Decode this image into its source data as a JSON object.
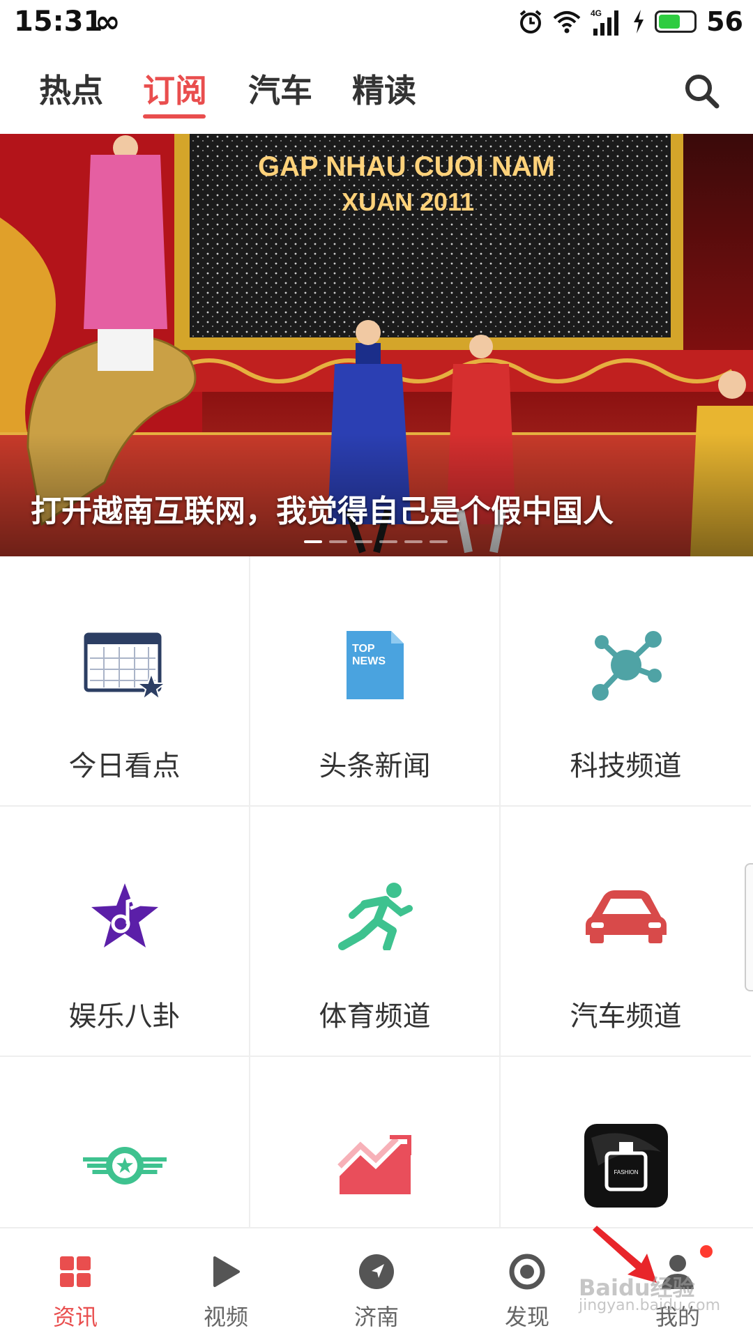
{
  "status_bar": {
    "time": "15:31",
    "infinity": "∞",
    "network": "4G",
    "battery": "56",
    "battery_level": 0.56
  },
  "top_tabs": [
    {
      "label": "热点",
      "active": false
    },
    {
      "label": "订阅",
      "active": true
    },
    {
      "label": "汽车",
      "active": false
    },
    {
      "label": "精读",
      "active": false
    }
  ],
  "banner": {
    "headline": "打开越南互联网，我觉得自己是个假中国人",
    "stage_text_line1": "GAP NHAU CUOI NAM",
    "stage_text_line2": "XUAN 2011",
    "page_count": 6,
    "active_page": 1
  },
  "grid": [
    {
      "label": "今日看点",
      "icon": "calendar-star-icon"
    },
    {
      "label": "头条新闻",
      "icon": "top-news-icon",
      "icon_text_1": "TOP",
      "icon_text_2": "NEWS"
    },
    {
      "label": "科技频道",
      "icon": "molecule-icon"
    },
    {
      "label": "娱乐八卦",
      "icon": "music-star-icon"
    },
    {
      "label": "体育频道",
      "icon": "runner-icon"
    },
    {
      "label": "汽车频道",
      "icon": "car-icon"
    },
    {
      "label": "",
      "icon": "wing-star-icon"
    },
    {
      "label": "",
      "icon": "trend-chart-icon"
    },
    {
      "label": "",
      "icon": "fashion-perfume-icon",
      "icon_text": "FASHION"
    }
  ],
  "bottom_nav": [
    {
      "label": "资讯",
      "icon": "grid-icon",
      "active": true
    },
    {
      "label": "视频",
      "icon": "play-icon",
      "active": false
    },
    {
      "label": "济南",
      "icon": "compass-icon",
      "active": false
    },
    {
      "label": "发现",
      "icon": "target-icon",
      "active": false
    },
    {
      "label": "我的",
      "icon": "user-icon",
      "active": false
    }
  ],
  "watermark": {
    "brand": "Baidu经验",
    "url": "jingyan.baidu.com"
  },
  "colors": {
    "accent": "#e94e4e",
    "calendar": "#2c3e63",
    "news": "#4aa3df",
    "tech": "#4fa3a5",
    "entertainment": "#5b1fa8",
    "sport": "#3ec28f",
    "car": "#d84a4a",
    "wing": "#3ec28f",
    "trend": "#e94e5b"
  }
}
